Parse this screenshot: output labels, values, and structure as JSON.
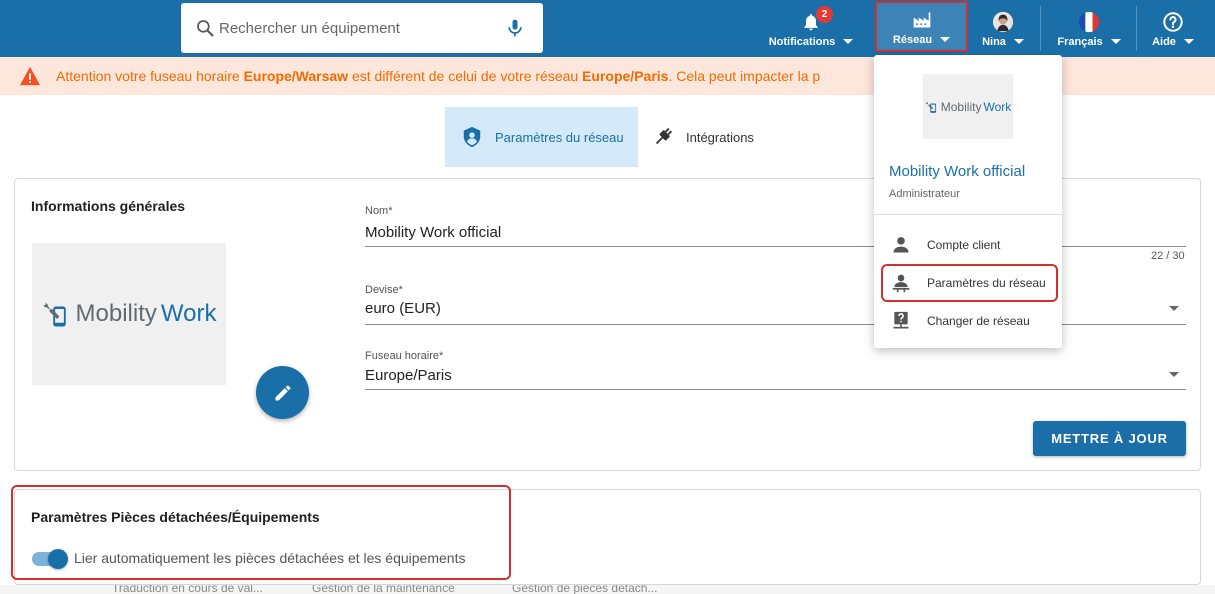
{
  "search": {
    "placeholder": "Rechercher un équipement",
    "icon": "search-icon",
    "mic_icon": "microphone-icon"
  },
  "nav": {
    "notifications": {
      "label": "Notifications",
      "badge": "2",
      "icon": "bell-icon"
    },
    "reseau": {
      "label": "Réseau",
      "icon": "factory-icon"
    },
    "user": {
      "label": "Nina",
      "icon": "avatar"
    },
    "language": {
      "label": "Français",
      "icon": "french-flag-icon"
    },
    "help": {
      "label": "Aide",
      "icon": "help-circle-icon"
    }
  },
  "alert": {
    "prefix": "Attention votre fuseau horaire ",
    "tz_user": "Europe/Warsaw",
    "middle": " est différent de celui de votre réseau ",
    "tz_network": "Europe/Paris",
    "suffix": ". Cela peut impacter la p"
  },
  "tabs": [
    {
      "label": "Paramètres du réseau",
      "icon": "shield-user-icon",
      "active": true
    },
    {
      "label": "Intégrations",
      "icon": "plug-icon",
      "active": false
    }
  ],
  "general": {
    "title": "Informations générales",
    "logo_text_1": "Mobility",
    "logo_text_2": "Work",
    "name_label": "Nom*",
    "name_value": "Mobility Work official",
    "name_counter": "22 / 30",
    "currency_label": "Devise*",
    "currency_value": "euro (EUR)",
    "timezone_label": "Fuseau horaire*",
    "timezone_value": "Europe/Paris",
    "update_button": "METTRE À JOUR"
  },
  "parts": {
    "title": "Paramètres Pièces détachées/Équipements",
    "toggle_label": "Lier automatiquement les pièces détachées et les équipements",
    "toggle_on": true
  },
  "menu": {
    "logo_text_1": "Mobility",
    "logo_text_2": "Work",
    "network_name": "Mobility Work official",
    "role": "Administrateur",
    "items": [
      {
        "label": "Compte client",
        "icon": "person-icon"
      },
      {
        "label": "Paramètres du réseau",
        "icon": "person-settings-icon"
      },
      {
        "label": "Changer de réseau",
        "icon": "switch-network-icon"
      }
    ]
  },
  "bottom": {
    "col1": "Traduction en cours de val...",
    "col2": "Gestion de la maintenance",
    "col3": "Gestion de pièces détach..."
  },
  "colors": {
    "primary": "#1a6fa8",
    "alert_bg": "#fde6dc",
    "alert_text": "#ef6c00",
    "highlight": "#d32f2f"
  }
}
